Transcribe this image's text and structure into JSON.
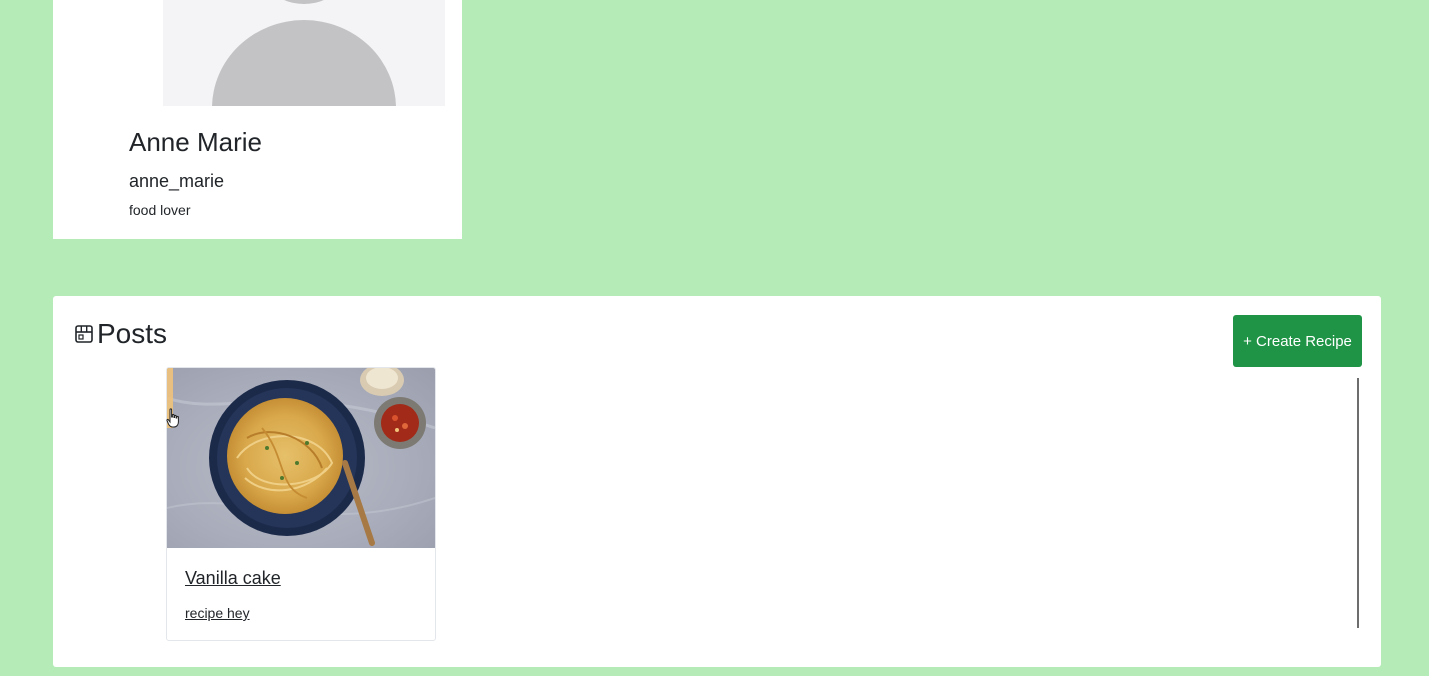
{
  "profile": {
    "name": "Anne Marie",
    "username": "anne_marie",
    "bio": "food lover"
  },
  "posts": {
    "title": "Posts",
    "title_icon": "shop-icon",
    "create_button_label": "+ Create Recipe",
    "items": [
      {
        "title": "Vanilla cake",
        "description": "recipe hey"
      }
    ]
  },
  "colors": {
    "page_background": "#b5ebb7",
    "card_background": "#ffffff",
    "button_green": "#1f9446"
  }
}
